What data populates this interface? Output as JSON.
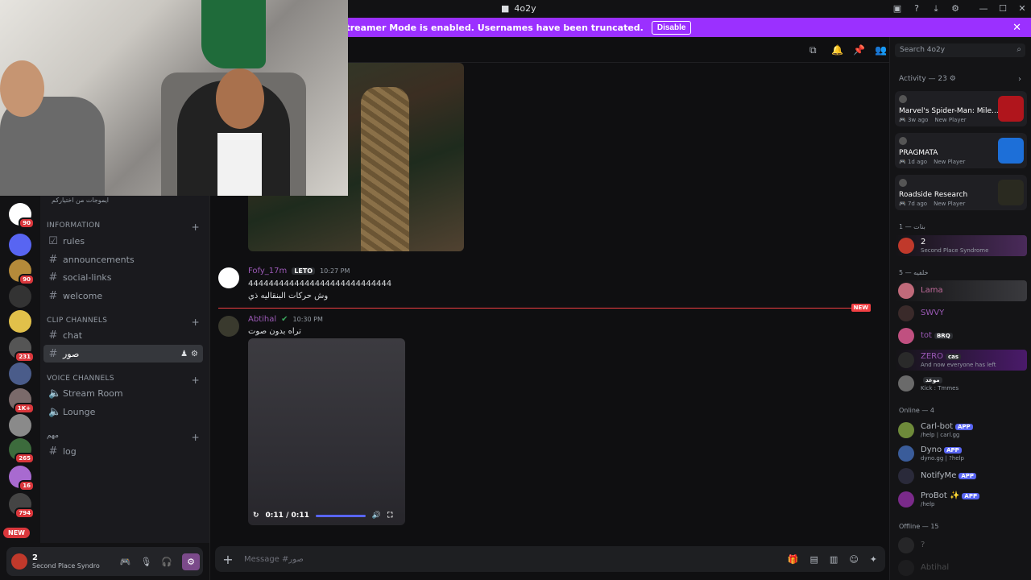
{
  "window": {
    "title": "4o2y"
  },
  "banner": {
    "text": "Streamer Mode is enabled. Usernames have been truncated.",
    "button": "Disable"
  },
  "servers": [
    {
      "badge": "90",
      "color": "#ffffff"
    },
    {
      "badge": "",
      "color": "#5865f2"
    },
    {
      "badge": "90",
      "color": "#b58a3a"
    },
    {
      "badge": "",
      "color": "#333333"
    },
    {
      "badge": "",
      "color": "#e1c04a"
    },
    {
      "badge": "231",
      "color": "#555555"
    },
    {
      "badge": "",
      "color": "#4a5c8a"
    },
    {
      "badge": "1K+",
      "color": "#7a6a6a"
    },
    {
      "badge": "",
      "color": "#8a8a8a"
    },
    {
      "badge": "265",
      "color": "#3c6b3c"
    },
    {
      "badge": "16",
      "color": "#a86ad0"
    },
    {
      "badge": "794",
      "color": "#444444"
    }
  ],
  "new_pill": "NEW",
  "channels": {
    "header_snippet": "ايموجات من اختياركم",
    "categories": [
      {
        "name": "INFORMATION",
        "items": [
          "rules",
          "announcements",
          "social-links",
          "welcome"
        ]
      },
      {
        "name": "Clip Channels",
        "items": [
          "chat",
          "صور"
        ]
      },
      {
        "name": "Voice Channels",
        "items": [
          "Stream Room",
          "Lounge"
        ]
      },
      {
        "name": "مهم",
        "items": [
          "log"
        ]
      }
    ]
  },
  "user_panel": {
    "name": "2",
    "status": "Second Place Syndro"
  },
  "messages": [
    {
      "author": "Fofy_17m",
      "tag": "LETO",
      "time": "10:27 PM",
      "lines": [
        "4444444444444444444444444444",
        "وش حركات البنقاليه ذي"
      ]
    },
    {
      "author": "Abtihal",
      "time": "10:30 PM",
      "lines": [
        "تراه بدون صوت"
      ]
    }
  ],
  "new_marker": "NEW",
  "video": {
    "time": "0:11 / 0:11",
    "progress": 1.0
  },
  "composer": {
    "placeholder": "Message #صور"
  },
  "search": {
    "placeholder": "Search 4o2y"
  },
  "activity": {
    "label": "Activity — 23",
    "cards": [
      {
        "title": "Marvel's Spider-Man: Mile...",
        "meta": "3w ago",
        "tag": "New Player",
        "color": "#b0151c"
      },
      {
        "title": "PRAGMATA",
        "meta": "1d ago",
        "tag": "New Player",
        "color": "#1d6fd8"
      },
      {
        "title": "Roadside Research",
        "meta": "7d ago",
        "tag": "New Player",
        "color": "#c8a82a"
      }
    ]
  },
  "member_groups": {
    "g1": "بنات — 1",
    "g1_members": [
      {
        "name": "2",
        "sub": "Second Place Syndrome",
        "color": "#c0392b"
      }
    ],
    "g2": "خلفيه — 5",
    "g2_members": [
      {
        "name": "Lama",
        "sub": "",
        "color": "#c06a7a"
      },
      {
        "name": "SWVY",
        "sub": "",
        "color": "#3a2a2a"
      },
      {
        "name": "tot",
        "chip": "BRQ",
        "sub": "",
        "color": "#c05080"
      },
      {
        "name": "ZERO",
        "chip": "cas",
        "sub": "And now everyone has left",
        "color": "#2a2a2a"
      },
      {
        "name": "",
        "chip": "موعد",
        "sub": "Kick : Tmmes",
        "color": "#6a6a6a"
      }
    ],
    "online": "Online — 4",
    "online_members": [
      {
        "name": "Carl-bot",
        "app": "APP",
        "sub": "/help | carl.gg",
        "color": "#6e8a3a"
      },
      {
        "name": "Dyno",
        "app": "APP",
        "sub": "dyno.gg | ?help",
        "color": "#3a5c9a"
      },
      {
        "name": "NotifyMe",
        "app": "APP",
        "sub": "",
        "color": "#2a2a3a"
      },
      {
        "name": "ProBot ✨",
        "app": "APP",
        "sub": "/help",
        "color": "#7a2a8a"
      }
    ],
    "offline": "Offline — 15",
    "offline_members": [
      {
        "name": "?",
        "color": "#4a4a4a"
      },
      {
        "name": "Abtihal",
        "color": "#3a3a3a"
      }
    ]
  }
}
